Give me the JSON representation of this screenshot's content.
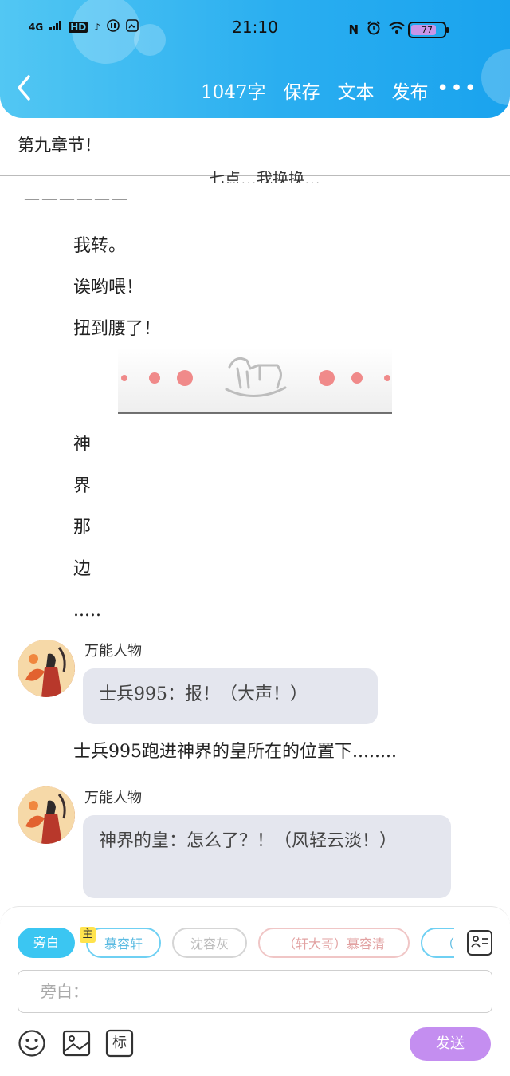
{
  "status_bar": {
    "network": "4G",
    "hd": "HD",
    "time": "21:10",
    "battery": "77",
    "battery_level": 0.77
  },
  "header": {
    "back_icon": "chevron-left-icon",
    "word_count": "1047字",
    "save": "保存",
    "text": "文本",
    "publish": "发布",
    "more": "•••"
  },
  "chapter_title": "第九章节！",
  "content": {
    "clipped_top": "七点…我换换…",
    "dashes": "——————",
    "lines": [
      "我转。",
      "诶哟喂！",
      "扭到腰了！"
    ],
    "vertical_lines": [
      "神",
      "界",
      "那",
      "边",
      "....."
    ],
    "messages": [
      {
        "sender": "万能人物",
        "text": "士兵995：报！（大声！）"
      },
      {
        "sender": "万能人物",
        "text": "神界的皇：怎么了？！（风轻云淡！）"
      }
    ],
    "narration": "士兵995跑进神界的皇所在的位置下........"
  },
  "composer": {
    "chips": [
      "旁白",
      "慕容轩",
      "沈容灰",
      "（轩大哥）慕容清",
      "（"
    ],
    "main_badge": "主",
    "input_placeholder": "旁白：",
    "send": "发送",
    "tag_label": "标"
  },
  "colors": {
    "header_start": "#52c7f3",
    "header_end": "#1aa3ee",
    "accent": "#3bc6f2",
    "send_button": "#c48ef0",
    "bubble_bg": "#e4e6ee"
  }
}
